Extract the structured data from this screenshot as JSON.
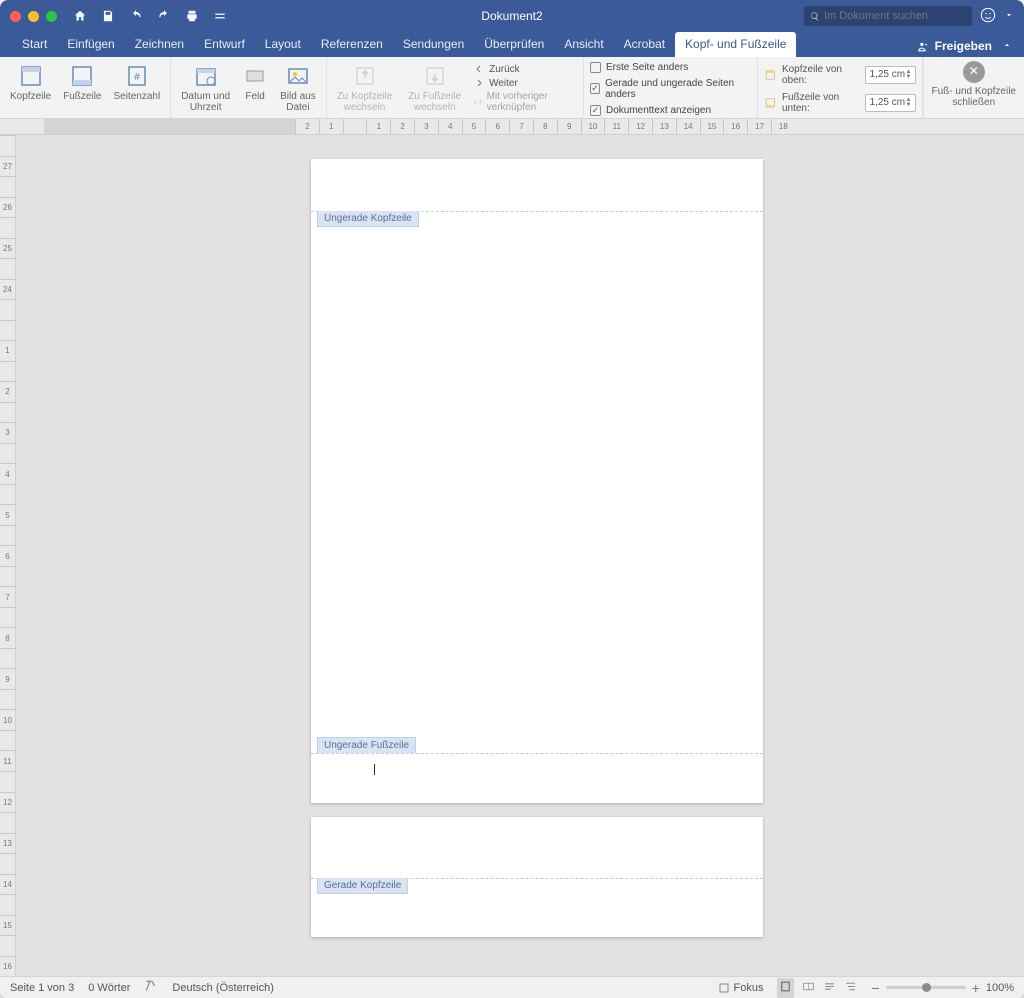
{
  "titlebar": {
    "document_title": "Dokument2",
    "search_placeholder": "Im Dokument suchen"
  },
  "tabs": {
    "items": [
      "Start",
      "Einfügen",
      "Zeichnen",
      "Entwurf",
      "Layout",
      "Referenzen",
      "Sendungen",
      "Überprüfen",
      "Ansicht",
      "Acrobat",
      "Kopf- und Fußzeile"
    ],
    "active_index": 10,
    "share_label": "Freigeben"
  },
  "ribbon": {
    "header_group": {
      "kopfzeile": "Kopfzeile",
      "fusszeile": "Fußzeile",
      "seitenzahl": "Seitenzahl"
    },
    "insert_group": {
      "datum": "Datum und\nUhrzeit",
      "feld": "Feld",
      "bild": "Bild aus\nDatei"
    },
    "nav_group": {
      "zu_kopf": "Zu Kopfzeile\nwechseln",
      "zu_fuss": "Zu Fußzeile\nwechseln",
      "zurueck": "Zurück",
      "weiter": "Weiter",
      "verknuepfen": "Mit vorheriger verknüpfen"
    },
    "options_group": {
      "erste_seite": {
        "label": "Erste Seite anders",
        "checked": false
      },
      "gerade_ungerade": {
        "label": "Gerade und ungerade Seiten anders",
        "checked": true
      },
      "dokumenttext": {
        "label": "Dokumenttext anzeigen",
        "checked": true
      }
    },
    "position_group": {
      "kopf_label": "Kopfzeile von oben:",
      "kopf_value": "1,25 cm",
      "fuss_label": "Fußzeile von unten:",
      "fuss_value": "1,25 cm"
    },
    "close_group": {
      "label": "Fuß- und Kopfzeile\nschließen"
    }
  },
  "ruler_h_marks": [
    "2",
    "1",
    "",
    "1",
    "2",
    "3",
    "4",
    "5",
    "6",
    "7",
    "8",
    "9",
    "10",
    "11",
    "12",
    "13",
    "14",
    "15",
    "16",
    "17",
    "18"
  ],
  "ruler_v_marks": [
    "",
    "27",
    "",
    "26",
    "",
    "25",
    "",
    "24",
    "",
    "",
    "1",
    "",
    "2",
    "",
    "3",
    "",
    "4",
    "",
    "5",
    "",
    "6",
    "",
    "7",
    "",
    "8",
    "",
    "9",
    "",
    "10",
    "",
    "11",
    "",
    "12",
    "",
    "13",
    "",
    "14",
    "",
    "15",
    "",
    "16"
  ],
  "document": {
    "page1_header_tag": "Ungerade Kopfzeile",
    "page1_footer_tag": "Ungerade Fußzeile",
    "page2_header_tag": "Gerade Kopfzeile"
  },
  "status": {
    "page": "Seite 1 von 3",
    "words": "0 Wörter",
    "language": "Deutsch (Österreich)",
    "focus": "Fokus",
    "zoom": "100%"
  }
}
